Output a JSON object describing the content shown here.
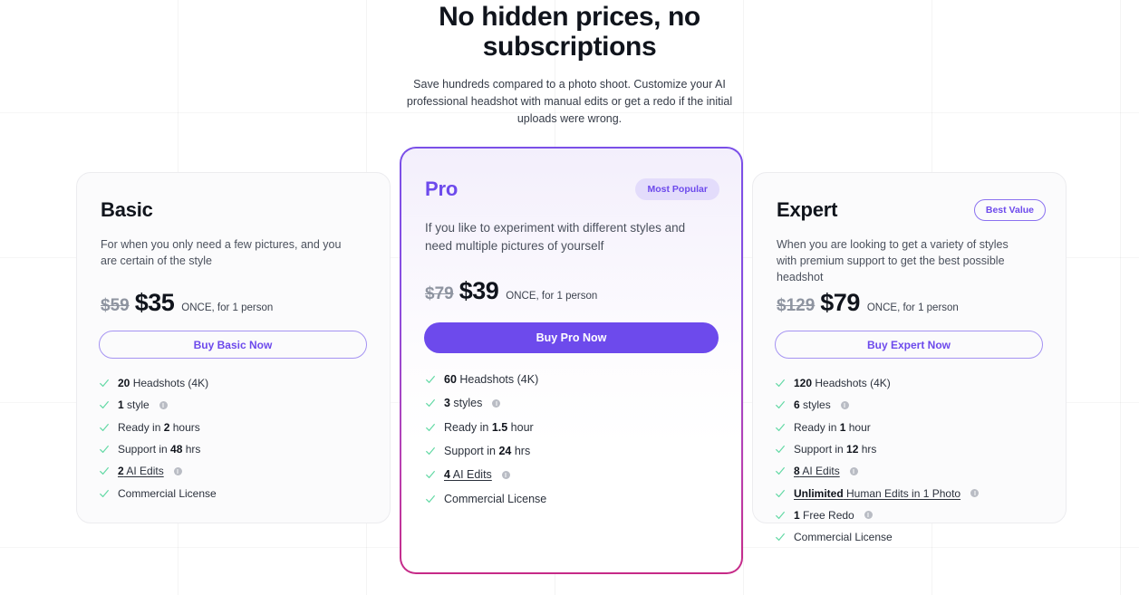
{
  "header": {
    "headline": "No hidden prices, no subscriptions",
    "subhead": "Save hundreds compared to a photo shoot. Customize your AI professional headshot with manual edits or get a redo if the initial uploads were wrong."
  },
  "colors": {
    "accent": "#6d4aec",
    "badge_fill": "#e3dcfb",
    "check": "#63d9a5",
    "price_old": "#8e94a0",
    "pro_border_start": "#7a4fe8",
    "pro_border_end": "#c62a87"
  },
  "price_note": "ONCE, for 1 person",
  "plans": [
    {
      "name": "Basic",
      "badge": null,
      "description": "For when you only need a few pictures, and you are certain of the style",
      "price_old": "$59",
      "price_new": "$35",
      "price_note": "ONCE, for 1 person",
      "cta": "Buy Basic Now",
      "features": [
        {
          "bold": "20",
          "rest": " Headshots (4K)",
          "info": false,
          "underline": false
        },
        {
          "bold": "1",
          "rest": " style",
          "info": true,
          "underline": false
        },
        {
          "pre": "Ready in ",
          "bold": "2",
          "rest": " hours",
          "info": false,
          "underline": false
        },
        {
          "pre": "Support in ",
          "bold": "48",
          "rest": " hrs",
          "info": false,
          "underline": false
        },
        {
          "bold": "2",
          "rest": " AI Edits",
          "info": true,
          "underline": true
        },
        {
          "bold": "",
          "rest": "Commercial License",
          "info": false,
          "underline": false
        }
      ]
    },
    {
      "name": "Pro",
      "badge": "Most Popular",
      "description": "If you like to experiment with different styles and need multiple pictures of yourself",
      "price_old": "$79",
      "price_new": "$39",
      "price_note": "ONCE, for 1 person",
      "cta": "Buy Pro Now",
      "features": [
        {
          "bold": "60",
          "rest": " Headshots (4K)",
          "info": false,
          "underline": false
        },
        {
          "bold": "3",
          "rest": " styles",
          "info": true,
          "underline": false
        },
        {
          "pre": "Ready in ",
          "bold": "1.5",
          "rest": " hour",
          "info": false,
          "underline": false
        },
        {
          "pre": "Support in ",
          "bold": "24",
          "rest": " hrs",
          "info": false,
          "underline": false
        },
        {
          "bold": "4",
          "rest": " AI Edits",
          "info": true,
          "underline": true
        },
        {
          "bold": "",
          "rest": "Commercial License",
          "info": false,
          "underline": false
        }
      ]
    },
    {
      "name": "Expert",
      "badge": "Best Value",
      "description": "When you are looking to get a variety of styles with premium support to get the best possible headshot",
      "price_old": "$129",
      "price_new": "$79",
      "price_note": "ONCE, for 1 person",
      "cta": "Buy Expert Now",
      "features": [
        {
          "bold": "120",
          "rest": " Headshots (4K)",
          "info": false,
          "underline": false
        },
        {
          "bold": "6",
          "rest": " styles",
          "info": true,
          "underline": false
        },
        {
          "pre": "Ready in ",
          "bold": "1",
          "rest": " hour",
          "info": false,
          "underline": false
        },
        {
          "pre": "Support in ",
          "bold": "12",
          "rest": " hrs",
          "info": false,
          "underline": false
        },
        {
          "bold": "8",
          "rest": " AI Edits",
          "info": true,
          "underline": true
        },
        {
          "bold": "Unlimited",
          "rest": " Human Edits in 1 Photo",
          "info": true,
          "underline": true
        },
        {
          "bold": "1",
          "rest": " Free Redo",
          "info": true,
          "underline": false
        },
        {
          "bold": "",
          "rest": "Commercial License",
          "info": false,
          "underline": false
        }
      ]
    }
  ]
}
